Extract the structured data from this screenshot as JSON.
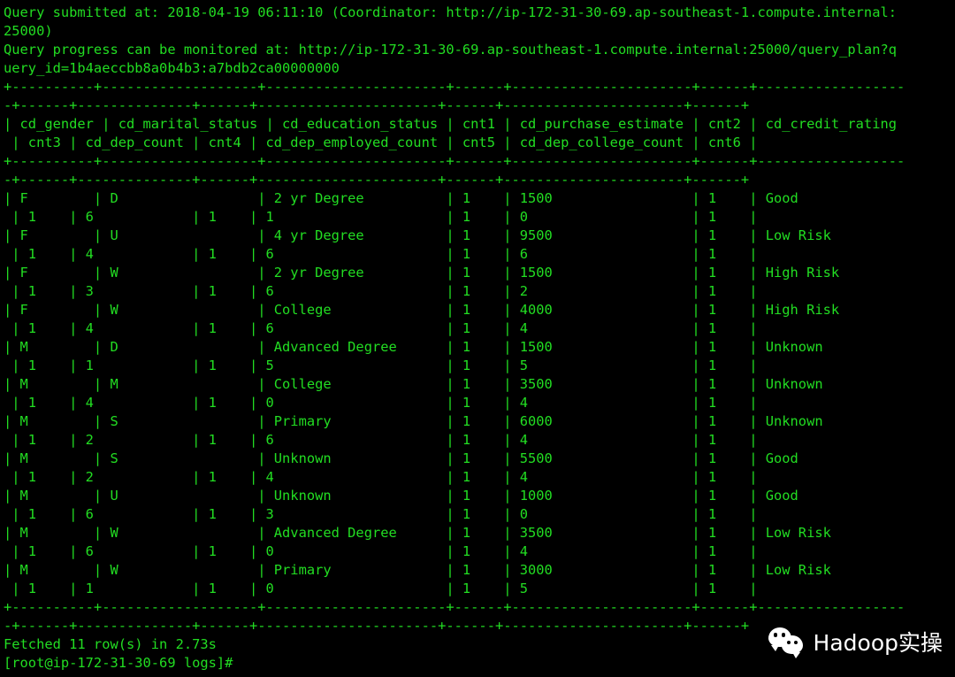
{
  "terminal": {
    "foreground_color": "#22dd22",
    "background_color": "#000000",
    "header_lines": [
      "Query submitted at: 2018-04-19 06:11:10 (Coordinator: http://ip-172-31-30-69.ap-southeast-1.compute.internal:",
      "25000)",
      "Query progress can be monitored at: http://ip-172-31-30-69.ap-southeast-1.compute.internal:25000/query_plan?q",
      "uery_id=1b4aeccbb8a0b4b3:a7bdb2ca00000000"
    ],
    "separator_lines": [
      "+----------+-------------------+----------------------+------+----------------------+------+------------------",
      "-+------+--------------+------+----------------------+------+----------------------+------+"
    ],
    "header_row_lines": [
      "| cd_gender | cd_marital_status | cd_education_status | cnt1 | cd_purchase_estimate | cnt2 | cd_credit_rating",
      " | cnt3 | cd_dep_count | cnt4 | cd_dep_employed_count | cnt5 | cd_dep_college_count | cnt6 |"
    ],
    "columns": [
      "cd_gender",
      "cd_marital_status",
      "cd_education_status",
      "cnt1",
      "cd_purchase_estimate",
      "cnt2",
      "cd_credit_rating",
      "cnt3",
      "cd_dep_count",
      "cnt4",
      "cd_dep_employed_count",
      "cnt5",
      "cd_dep_college_count",
      "cnt6"
    ],
    "rows": [
      {
        "line_a": "| F        | D                 | 2 yr Degree          | 1    | 1500                 | 1    | Good",
        "line_b": " | 1    | 6            | 1    | 1                     | 1    | 0                    | 1    |",
        "cd_gender": "F",
        "cd_marital_status": "D",
        "cd_education_status": "2 yr Degree",
        "cnt1": "1",
        "cd_purchase_estimate": "1500",
        "cnt2": "1",
        "cd_credit_rating": "Good",
        "cnt3": "1",
        "cd_dep_count": "6",
        "cnt4": "1",
        "cd_dep_employed_count": "1",
        "cnt5": "1",
        "cd_dep_college_count": "0",
        "cnt6": "1"
      },
      {
        "line_a": "| F        | U                 | 4 yr Degree          | 1    | 9500                 | 1    | Low Risk",
        "line_b": " | 1    | 4            | 1    | 6                     | 1    | 6                    | 1    |",
        "cd_gender": "F",
        "cd_marital_status": "U",
        "cd_education_status": "4 yr Degree",
        "cnt1": "1",
        "cd_purchase_estimate": "9500",
        "cnt2": "1",
        "cd_credit_rating": "Low Risk",
        "cnt3": "1",
        "cd_dep_count": "4",
        "cnt4": "1",
        "cd_dep_employed_count": "6",
        "cnt5": "1",
        "cd_dep_college_count": "6",
        "cnt6": "1"
      },
      {
        "line_a": "| F        | W                 | 2 yr Degree          | 1    | 1500                 | 1    | High Risk",
        "line_b": " | 1    | 3            | 1    | 6                     | 1    | 2                    | 1    |",
        "cd_gender": "F",
        "cd_marital_status": "W",
        "cd_education_status": "2 yr Degree",
        "cnt1": "1",
        "cd_purchase_estimate": "1500",
        "cnt2": "1",
        "cd_credit_rating": "High Risk",
        "cnt3": "1",
        "cd_dep_count": "3",
        "cnt4": "1",
        "cd_dep_employed_count": "6",
        "cnt5": "1",
        "cd_dep_college_count": "2",
        "cnt6": "1"
      },
      {
        "line_a": "| F        | W                 | College              | 1    | 4000                 | 1    | High Risk",
        "line_b": " | 1    | 4            | 1    | 6                     | 1    | 4                    | 1    |",
        "cd_gender": "F",
        "cd_marital_status": "W",
        "cd_education_status": "College",
        "cnt1": "1",
        "cd_purchase_estimate": "4000",
        "cnt2": "1",
        "cd_credit_rating": "High Risk",
        "cnt3": "1",
        "cd_dep_count": "4",
        "cnt4": "1",
        "cd_dep_employed_count": "6",
        "cnt5": "1",
        "cd_dep_college_count": "4",
        "cnt6": "1"
      },
      {
        "line_a": "| M        | D                 | Advanced Degree      | 1    | 1500                 | 1    | Unknown",
        "line_b": " | 1    | 1            | 1    | 5                     | 1    | 5                    | 1    |",
        "cd_gender": "M",
        "cd_marital_status": "D",
        "cd_education_status": "Advanced Degree",
        "cnt1": "1",
        "cd_purchase_estimate": "1500",
        "cnt2": "1",
        "cd_credit_rating": "Unknown",
        "cnt3": "1",
        "cd_dep_count": "1",
        "cnt4": "1",
        "cd_dep_employed_count": "5",
        "cnt5": "1",
        "cd_dep_college_count": "5",
        "cnt6": "1"
      },
      {
        "line_a": "| M        | M                 | College              | 1    | 3500                 | 1    | Unknown",
        "line_b": " | 1    | 4            | 1    | 0                     | 1    | 4                    | 1    |",
        "cd_gender": "M",
        "cd_marital_status": "M",
        "cd_education_status": "College",
        "cnt1": "1",
        "cd_purchase_estimate": "3500",
        "cnt2": "1",
        "cd_credit_rating": "Unknown",
        "cnt3": "1",
        "cd_dep_count": "4",
        "cnt4": "1",
        "cd_dep_employed_count": "0",
        "cnt5": "1",
        "cd_dep_college_count": "4",
        "cnt6": "1"
      },
      {
        "line_a": "| M        | S                 | Primary              | 1    | 6000                 | 1    | Unknown",
        "line_b": " | 1    | 2            | 1    | 6                     | 1    | 4                    | 1    |",
        "cd_gender": "M",
        "cd_marital_status": "S",
        "cd_education_status": "Primary",
        "cnt1": "1",
        "cd_purchase_estimate": "6000",
        "cnt2": "1",
        "cd_credit_rating": "Unknown",
        "cnt3": "1",
        "cd_dep_count": "2",
        "cnt4": "1",
        "cd_dep_employed_count": "6",
        "cnt5": "1",
        "cd_dep_college_count": "4",
        "cnt6": "1"
      },
      {
        "line_a": "| M        | S                 | Unknown              | 1    | 5500                 | 1    | Good",
        "line_b": " | 1    | 2            | 1    | 4                     | 1    | 4                    | 1    |",
        "cd_gender": "M",
        "cd_marital_status": "S",
        "cd_education_status": "Unknown",
        "cnt1": "1",
        "cd_purchase_estimate": "5500",
        "cnt2": "1",
        "cd_credit_rating": "Good",
        "cnt3": "1",
        "cd_dep_count": "2",
        "cnt4": "1",
        "cd_dep_employed_count": "4",
        "cnt5": "1",
        "cd_dep_college_count": "4",
        "cnt6": "1"
      },
      {
        "line_a": "| M        | U                 | Unknown              | 1    | 1000                 | 1    | Good",
        "line_b": " | 1    | 6            | 1    | 3                     | 1    | 0                    | 1    |",
        "cd_gender": "M",
        "cd_marital_status": "U",
        "cd_education_status": "Unknown",
        "cnt1": "1",
        "cd_purchase_estimate": "1000",
        "cnt2": "1",
        "cd_credit_rating": "Good",
        "cnt3": "1",
        "cd_dep_count": "6",
        "cnt4": "1",
        "cd_dep_employed_count": "3",
        "cnt5": "1",
        "cd_dep_college_count": "0",
        "cnt6": "1"
      },
      {
        "line_a": "| M        | W                 | Advanced Degree      | 1    | 3500                 | 1    | Low Risk",
        "line_b": " | 1    | 6            | 1    | 0                     | 1    | 4                    | 1    |",
        "cd_gender": "M",
        "cd_marital_status": "W",
        "cd_education_status": "Advanced Degree",
        "cnt1": "1",
        "cd_purchase_estimate": "3500",
        "cnt2": "1",
        "cd_credit_rating": "Low Risk",
        "cnt3": "1",
        "cd_dep_count": "6",
        "cnt4": "1",
        "cd_dep_employed_count": "0",
        "cnt5": "1",
        "cd_dep_college_count": "4",
        "cnt6": "1"
      },
      {
        "line_a": "| M        | W                 | Primary              | 1    | 3000                 | 1    | Low Risk",
        "line_b": " | 1    | 1            | 1    | 0                     | 1    | 5                    | 1    |",
        "cd_gender": "M",
        "cd_marital_status": "W",
        "cd_education_status": "Primary",
        "cnt1": "1",
        "cd_purchase_estimate": "3000",
        "cnt2": "1",
        "cd_credit_rating": "Low Risk",
        "cnt3": "1",
        "cd_dep_count": "1",
        "cnt4": "1",
        "cd_dep_employed_count": "0",
        "cnt5": "1",
        "cd_dep_college_count": "5",
        "cnt6": "1"
      }
    ],
    "fetched_status": "Fetched 11 row(s) in 2.73s",
    "prompt": "[root@ip-172-31-30-69 logs]#"
  },
  "watermark": {
    "icon": "wechat-icon",
    "label": "Hadoop实操",
    "color": "#ffffff"
  }
}
